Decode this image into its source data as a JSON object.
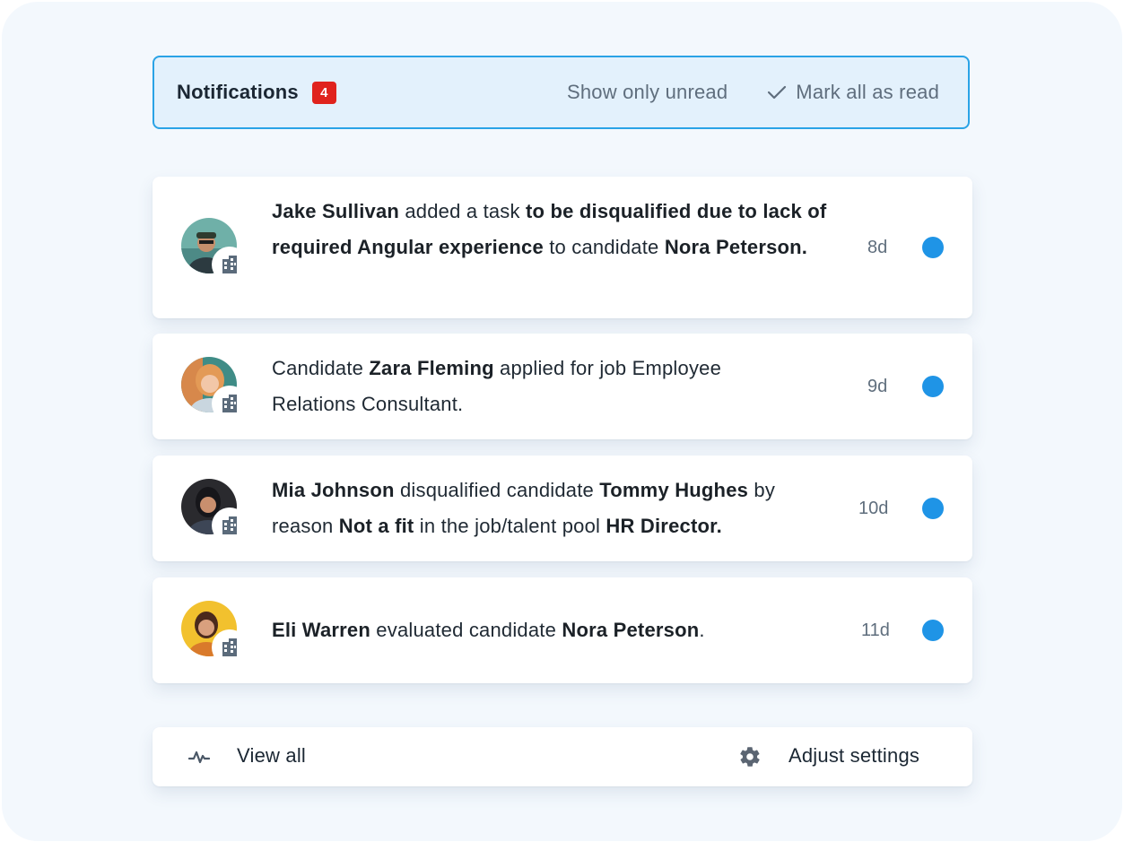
{
  "header": {
    "title": "Notifications",
    "badge_count": "4",
    "show_unread_label": "Show only unread",
    "mark_all_read_label": "Mark all as read"
  },
  "notifications": [
    {
      "segments": [
        {
          "t": "Jake Sullivan",
          "b": true
        },
        {
          "t": " added a task ",
          "b": false
        },
        {
          "t": "to be disqualified due to lack of required Angular experience",
          "b": true
        },
        {
          "t": " to candidate ",
          "b": false
        },
        {
          "t": "Nora Peterson.",
          "b": true
        }
      ],
      "age": "8d",
      "unread": true
    },
    {
      "segments": [
        {
          "t": "Candidate ",
          "b": false
        },
        {
          "t": "Zara Fleming",
          "b": true
        },
        {
          "t": " applied for job Employee Relations Consultant.",
          "b": false
        }
      ],
      "age": "9d",
      "unread": true
    },
    {
      "segments": [
        {
          "t": "Mia Johnson",
          "b": true
        },
        {
          "t": " disqualified candidate ",
          "b": false
        },
        {
          "t": "Tommy Hughes",
          "b": true
        },
        {
          "t": " by reason ",
          "b": false
        },
        {
          "t": "Not a fit",
          "b": true
        },
        {
          "t": " in the job/talent pool ",
          "b": false
        },
        {
          "t": "HR Director.",
          "b": true
        }
      ],
      "age": "10d",
      "unread": true
    },
    {
      "segments": [
        {
          "t": "Eli Warren",
          "b": true
        },
        {
          "t": " evaluated candidate ",
          "b": false
        },
        {
          "t": "Nora Peterson",
          "b": true
        },
        {
          "t": ".",
          "b": false
        }
      ],
      "age": "11d",
      "unread": true
    }
  ],
  "footer": {
    "view_all_label": "View all",
    "adjust_settings_label": "Adjust settings"
  },
  "icons": {
    "check": "check-icon",
    "activity": "activity-icon",
    "gear": "gear-icon",
    "building": "building-icon"
  },
  "colors": {
    "accent": "#2aa3e6",
    "badge": "#e0231d",
    "unread_dot": "#1f94e6"
  }
}
